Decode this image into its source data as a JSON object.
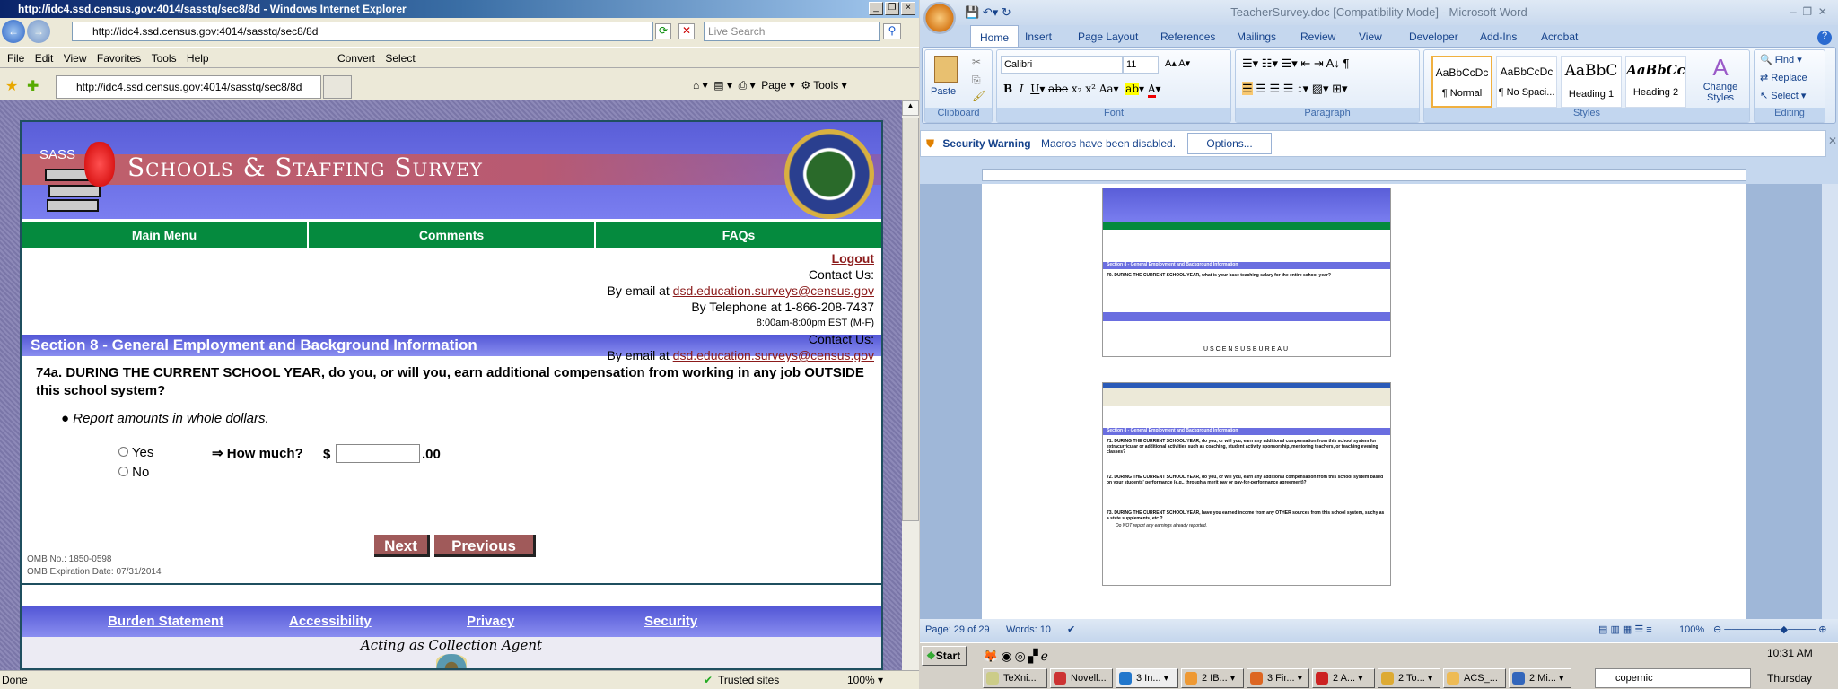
{
  "ie": {
    "title": "http://idc4.ssd.census.gov:4014/sasstq/sec8/8d - Windows Internet Explorer",
    "address": "http://idc4.ssd.census.gov:4014/sasstq/sec8/8d",
    "search_placeholder": "Live Search",
    "menu": [
      "File",
      "Edit",
      "View",
      "Favorites",
      "Tools",
      "Help"
    ],
    "convert": "Convert",
    "select": "Select",
    "tab_title": "http://idc4.ssd.census.gov:4014/sasstq/sec8/8d",
    "cmd": {
      "page": "Page",
      "tools": "Tools"
    },
    "status": {
      "text": "Done",
      "zone": "Trusted sites",
      "zoom": "100%"
    }
  },
  "web": {
    "logo_text": "SASS",
    "banner_title": "Schools & Staffing Survey",
    "seal_text": "Department of Education United States of America",
    "nav": [
      "Main Menu",
      "Comments",
      "FAQs"
    ],
    "logout": "Logout",
    "contact_label": "Contact Us:",
    "email_prefix": "By email at ",
    "email": "dsd.education.surveys@census.gov",
    "phone": "By Telephone at 1-866-208-7437",
    "hours": "8:00am-8:00pm EST (M-F)",
    "section": "Section 8 - General Employment and Background Information",
    "question": "74a. DURING THE CURRENT SCHOOL YEAR, do you, or will you, earn additional compensation from working in any job OUTSIDE this school system?",
    "instruction": "Report amounts in whole dollars.",
    "yes": "Yes",
    "no": "No",
    "how_much": "⇒ How much?",
    "dollar": "$",
    "cents": ".00",
    "amount_value": "",
    "next": "Next",
    "previous": "Previous",
    "omb_no": "OMB No.: 1850-0598",
    "omb_exp": "OMB Expiration Date: 07/31/2014",
    "footer_links": [
      "Burden Statement",
      "Accessibility",
      "Privacy",
      "Security"
    ],
    "agent": "Acting as Collection Agent"
  },
  "word": {
    "title": "TeacherSurvey.doc [Compatibility Mode] - Microsoft Word",
    "tabs": [
      "Home",
      "Insert",
      "Page Layout",
      "References",
      "Mailings",
      "Review",
      "View",
      "Developer",
      "Add-Ins",
      "Acrobat"
    ],
    "font": "Calibri",
    "size": "11",
    "groups": [
      "Clipboard",
      "Font",
      "Paragraph",
      "Styles",
      "Editing"
    ],
    "paste": "Paste",
    "styles": [
      {
        "sample": "AaBbCcDc",
        "name": "¶ Normal"
      },
      {
        "sample": "AaBbCcDc",
        "name": "¶ No Spaci..."
      },
      {
        "sample": "AaBbC",
        "name": "Heading 1"
      },
      {
        "sample": "AaBbCc",
        "name": "Heading 2"
      }
    ],
    "change_styles": "Change Styles",
    "editing": [
      "Find",
      "Replace",
      "Select"
    ],
    "security_title": "Security Warning",
    "security_msg": "Macros have been disabled.",
    "options": "Options...",
    "status": {
      "page": "Page: 29 of 29",
      "words": "Words: 10",
      "zoom": "100%"
    },
    "thumb1": {
      "section": "Section 8 - General Employment and Background Information",
      "question": "70. DURING THE CURRENT SCHOOL YEAR, what is your base teaching salary for the entire school year?",
      "census": "USCENSUSBUREAU"
    },
    "thumb2": {
      "q71": "71. DURING THE CURRENT SCHOOL YEAR, do you, or will you, earn any additional compensation from this school system for extracurricular or additional activities such as coaching, student activity sponsorship, mentoring teachers, or teaching evening classes?",
      "q72": "72. DURING THE CURRENT SCHOOL YEAR, do you, or will you, earn any additional compensation from this school system based on your students' performance (e.g., through a merit pay or pay-for-performance agreement)?",
      "q73": "73. DURING THE CURRENT SCHOOL YEAR, have you earned income from any OTHER sources from this school system, suchy as a state supplements, etc.?",
      "note": "Do NOT report any earnings already reported."
    }
  },
  "taskbar": {
    "start": "Start",
    "items": [
      "TeXni...",
      "Novell...",
      "3 In...",
      "2 IB...",
      "3 Fir...",
      "2 A...",
      "2 To...",
      "ACS_...",
      "2 Mi..."
    ],
    "search": "copernic",
    "time": "10:31 AM",
    "day": "Thursday"
  }
}
